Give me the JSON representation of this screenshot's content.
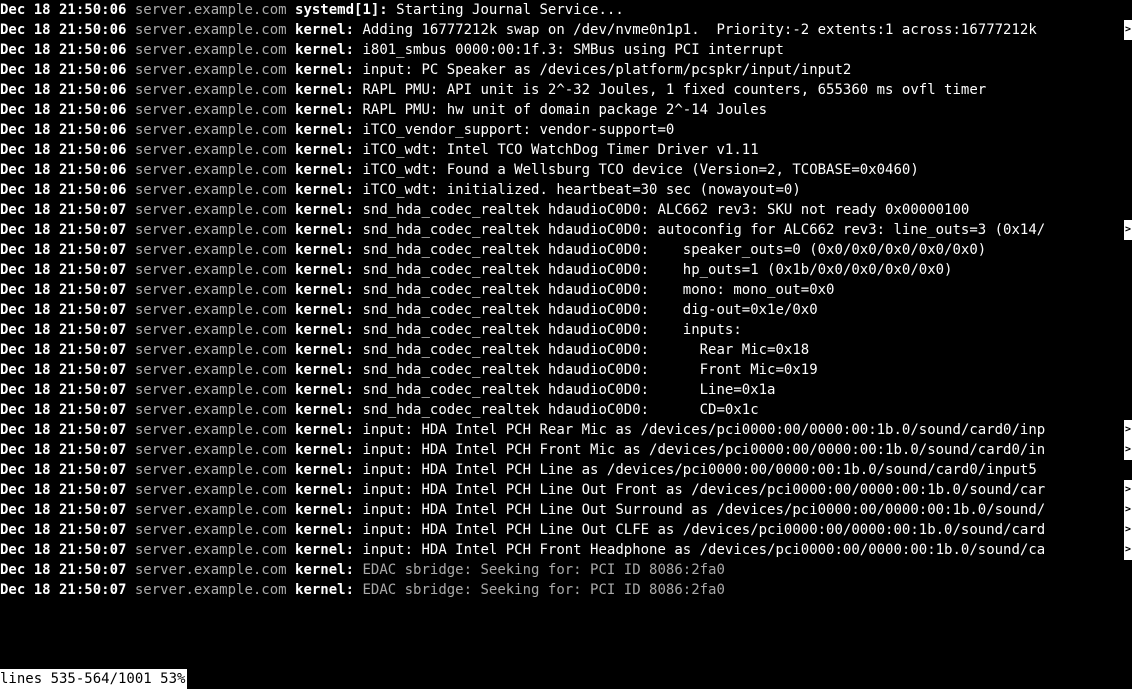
{
  "prefix_bold": "Dec 18 21:50:",
  "host": " server.example.com ",
  "lines": [
    {
      "sec": "06",
      "proc": "systemd[1]:",
      "msg": "Starting Journal Service...",
      "highlight": true,
      "overflow": false
    },
    {
      "sec": "06",
      "proc": "kernel:",
      "msg": "Adding 16777212k swap on /dev/nvme0n1p1.  Priority:-2 extents:1 across:16777212k ",
      "highlight": true,
      "overflow": true
    },
    {
      "sec": "06",
      "proc": "kernel:",
      "msg": "i801_smbus 0000:00:1f.3: SMBus using PCI interrupt",
      "highlight": true,
      "overflow": false
    },
    {
      "sec": "06",
      "proc": "kernel:",
      "msg": "input: PC Speaker as /devices/platform/pcspkr/input/input2",
      "highlight": true,
      "overflow": false
    },
    {
      "sec": "06",
      "proc": "kernel:",
      "msg": "RAPL PMU: API unit is 2^-32 Joules, 1 fixed counters, 655360 ms ovfl timer",
      "highlight": true,
      "overflow": false
    },
    {
      "sec": "06",
      "proc": "kernel:",
      "msg": "RAPL PMU: hw unit of domain package 2^-14 Joules",
      "highlight": true,
      "overflow": false
    },
    {
      "sec": "06",
      "proc": "kernel:",
      "msg": "iTCO_vendor_support: vendor-support=0",
      "highlight": true,
      "overflow": false
    },
    {
      "sec": "06",
      "proc": "kernel:",
      "msg": "iTCO_wdt: Intel TCO WatchDog Timer Driver v1.11",
      "highlight": true,
      "overflow": false
    },
    {
      "sec": "06",
      "proc": "kernel:",
      "msg": "iTCO_wdt: Found a Wellsburg TCO device (Version=2, TCOBASE=0x0460)",
      "highlight": true,
      "overflow": false
    },
    {
      "sec": "06",
      "proc": "kernel:",
      "msg": "iTCO_wdt: initialized. heartbeat=30 sec (nowayout=0)",
      "highlight": true,
      "overflow": false
    },
    {
      "sec": "07",
      "proc": "kernel:",
      "msg": "snd_hda_codec_realtek hdaudioC0D0: ALC662 rev3: SKU not ready 0x00000100",
      "highlight": true,
      "overflow": false
    },
    {
      "sec": "07",
      "proc": "kernel:",
      "msg": "snd_hda_codec_realtek hdaudioC0D0: autoconfig for ALC662 rev3: line_outs=3 (0x14/",
      "highlight": true,
      "overflow": true
    },
    {
      "sec": "07",
      "proc": "kernel:",
      "msg": "snd_hda_codec_realtek hdaudioC0D0:    speaker_outs=0 (0x0/0x0/0x0/0x0/0x0)",
      "highlight": true,
      "overflow": false
    },
    {
      "sec": "07",
      "proc": "kernel:",
      "msg": "snd_hda_codec_realtek hdaudioC0D0:    hp_outs=1 (0x1b/0x0/0x0/0x0/0x0)",
      "highlight": true,
      "overflow": false
    },
    {
      "sec": "07",
      "proc": "kernel:",
      "msg": "snd_hda_codec_realtek hdaudioC0D0:    mono: mono_out=0x0",
      "highlight": true,
      "overflow": false
    },
    {
      "sec": "07",
      "proc": "kernel:",
      "msg": "snd_hda_codec_realtek hdaudioC0D0:    dig-out=0x1e/0x0",
      "highlight": true,
      "overflow": false
    },
    {
      "sec": "07",
      "proc": "kernel:",
      "msg": "snd_hda_codec_realtek hdaudioC0D0:    inputs:",
      "highlight": true,
      "overflow": false
    },
    {
      "sec": "07",
      "proc": "kernel:",
      "msg": "snd_hda_codec_realtek hdaudioC0D0:      Rear Mic=0x18",
      "highlight": true,
      "overflow": false
    },
    {
      "sec": "07",
      "proc": "kernel:",
      "msg": "snd_hda_codec_realtek hdaudioC0D0:      Front Mic=0x19",
      "highlight": true,
      "overflow": false
    },
    {
      "sec": "07",
      "proc": "kernel:",
      "msg": "snd_hda_codec_realtek hdaudioC0D0:      Line=0x1a",
      "highlight": true,
      "overflow": false
    },
    {
      "sec": "07",
      "proc": "kernel:",
      "msg": "snd_hda_codec_realtek hdaudioC0D0:      CD=0x1c",
      "highlight": true,
      "overflow": false
    },
    {
      "sec": "07",
      "proc": "kernel:",
      "msg": "input: HDA Intel PCH Rear Mic as /devices/pci0000:00/0000:00:1b.0/sound/card0/inp",
      "highlight": true,
      "overflow": true
    },
    {
      "sec": "07",
      "proc": "kernel:",
      "msg": "input: HDA Intel PCH Front Mic as /devices/pci0000:00/0000:00:1b.0/sound/card0/in",
      "highlight": true,
      "overflow": true
    },
    {
      "sec": "07",
      "proc": "kernel:",
      "msg": "input: HDA Intel PCH Line as /devices/pci0000:00/0000:00:1b.0/sound/card0/input5",
      "highlight": true,
      "overflow": false
    },
    {
      "sec": "07",
      "proc": "kernel:",
      "msg": "input: HDA Intel PCH Line Out Front as /devices/pci0000:00/0000:00:1b.0/sound/car",
      "highlight": true,
      "overflow": true
    },
    {
      "sec": "07",
      "proc": "kernel:",
      "msg": "input: HDA Intel PCH Line Out Surround as /devices/pci0000:00/0000:00:1b.0/sound/",
      "highlight": true,
      "overflow": true
    },
    {
      "sec": "07",
      "proc": "kernel:",
      "msg": "input: HDA Intel PCH Line Out CLFE as /devices/pci0000:00/0000:00:1b.0/sound/card",
      "highlight": true,
      "overflow": true
    },
    {
      "sec": "07",
      "proc": "kernel:",
      "msg": "input: HDA Intel PCH Front Headphone as /devices/pci0000:00/0000:00:1b.0/sound/ca",
      "highlight": true,
      "overflow": true
    },
    {
      "sec": "07",
      "proc": "kernel:",
      "msg": "EDAC sbridge: Seeking for: PCI ID 8086:2fa0",
      "highlight": false,
      "overflow": false
    },
    {
      "sec": "07",
      "proc": "kernel:",
      "msg": "EDAC sbridge: Seeking for: PCI ID 8086:2fa0",
      "highlight": false,
      "overflow": false
    }
  ],
  "status": "lines 535-564/1001 53%",
  "overflow_glyph": ">"
}
